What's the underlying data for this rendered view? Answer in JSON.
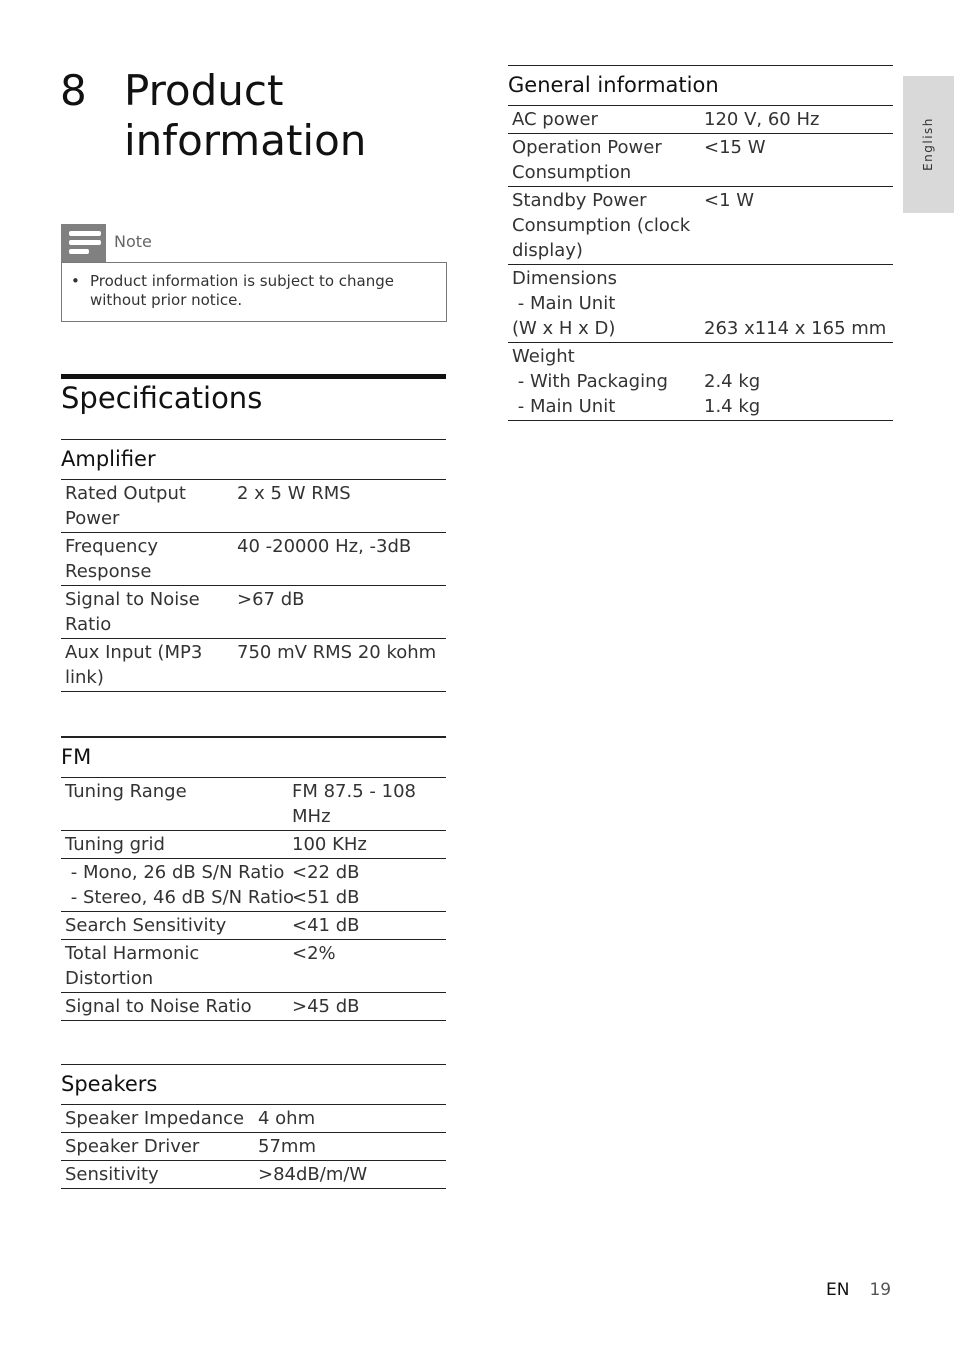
{
  "chapter": {
    "number": "8",
    "title": "Product information"
  },
  "note": {
    "label": "Note",
    "icon": "note-lines-icon",
    "bullet": "•",
    "items": [
      "Product information is subject to change without prior notice."
    ]
  },
  "specifications": {
    "title": "Specifications",
    "amplifier": {
      "title": "Amplifier",
      "rows": [
        {
          "label": "Rated Output\nPower",
          "value": "2 x 5 W RMS"
        },
        {
          "label": "Frequency\nResponse",
          "value": "40 -20000 Hz, -3dB"
        },
        {
          "label": "Signal to Noise\nRatio",
          "value": ">67 dB"
        },
        {
          "label": "Aux Input (MP3\nlink)",
          "value": "750 mV RMS 20 kohm"
        }
      ]
    },
    "fm": {
      "title": "FM",
      "rows": [
        {
          "label": "Tuning Range",
          "value": "FM 87.5 - 108\nMHz"
        },
        {
          "label": "Tuning grid",
          "value": "100 KHz"
        },
        {
          "label": " - Mono, 26 dB S/N Ratio\n - Stereo, 46 dB S/N Ratio",
          "value": "<22 dB\n<51 dB"
        },
        {
          "label": "Search Sensitivity",
          "value": "<41 dB"
        },
        {
          "label": "Total Harmonic\nDistortion",
          "value": "<2%"
        },
        {
          "label": "Signal to Noise Ratio",
          "value": ">45 dB"
        }
      ]
    },
    "speakers": {
      "title": "Speakers",
      "rows": [
        {
          "label": "Speaker Impedance",
          "value": "4 ohm"
        },
        {
          "label": "Speaker Driver",
          "value": "57mm"
        },
        {
          "label": "Sensitivity",
          "value": ">84dB/m/W"
        }
      ]
    }
  },
  "general": {
    "title": "General information",
    "rows": [
      {
        "label": "AC power",
        "value": "120 V, 60 Hz"
      },
      {
        "label": "Operation Power\nConsumption",
        "value": "<15 W"
      },
      {
        "label": "Standby Power\nConsumption (clock\ndisplay)",
        "value": "<1 W"
      },
      {
        "label": "Dimensions\n - Main Unit\n(W x H x D)",
        "value": "\n\n263 x114 x 165 mm"
      },
      {
        "label": "Weight\n - With Packaging\n - Main Unit",
        "value": "\n2.4 kg\n1.4 kg"
      }
    ]
  },
  "side_tab": {
    "language": "English"
  },
  "footer": {
    "lang": "EN",
    "page": "19"
  }
}
